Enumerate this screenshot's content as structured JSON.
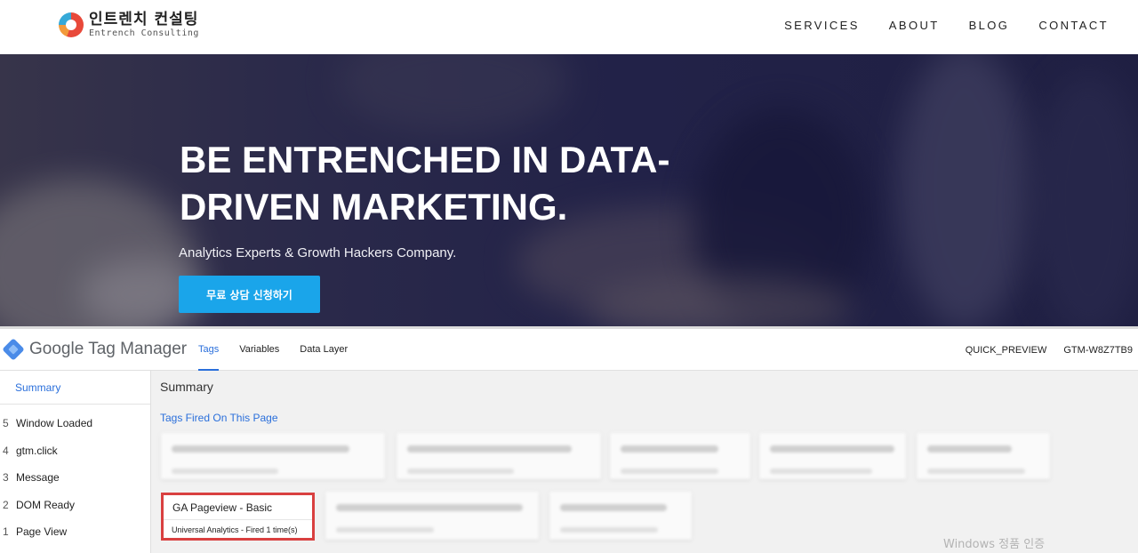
{
  "site": {
    "logo_korean": "인트렌치 컨설팅",
    "logo_english": "Entrench Consulting",
    "nav": [
      "SERVICES",
      "ABOUT",
      "BLOG",
      "CONTACT"
    ]
  },
  "hero": {
    "title": "BE ENTRENCHED IN DATA-DRIVEN MARKETING.",
    "subtitle": "Analytics Experts & Growth Hackers Company.",
    "cta_label": "무료 상담 신청하기",
    "cta_color": "#1aa5ea"
  },
  "gtm": {
    "product_name": "Google Tag Manager",
    "tabs": [
      "Tags",
      "Variables",
      "Data Layer"
    ],
    "active_tab": "Tags",
    "preview_label": "QUICK_PREVIEW",
    "container_id": "GTM-W8Z7TB9",
    "sidebar": {
      "summary_label": "Summary",
      "events": [
        {
          "num": "5",
          "label": "Window Loaded"
        },
        {
          "num": "4",
          "label": "gtm.click"
        },
        {
          "num": "3",
          "label": "Message"
        },
        {
          "num": "2",
          "label": "DOM Ready"
        },
        {
          "num": "1",
          "label": "Page View"
        }
      ]
    },
    "main": {
      "title": "Summary",
      "section_label": "Tags Fired On This Page",
      "highlighted_tag": {
        "name": "GA Pageview - Basic",
        "status": "Universal Analytics - Fired 1 time(s)",
        "highlight_color": "#d94040"
      }
    }
  },
  "watermark": "Windows 정품 인증"
}
